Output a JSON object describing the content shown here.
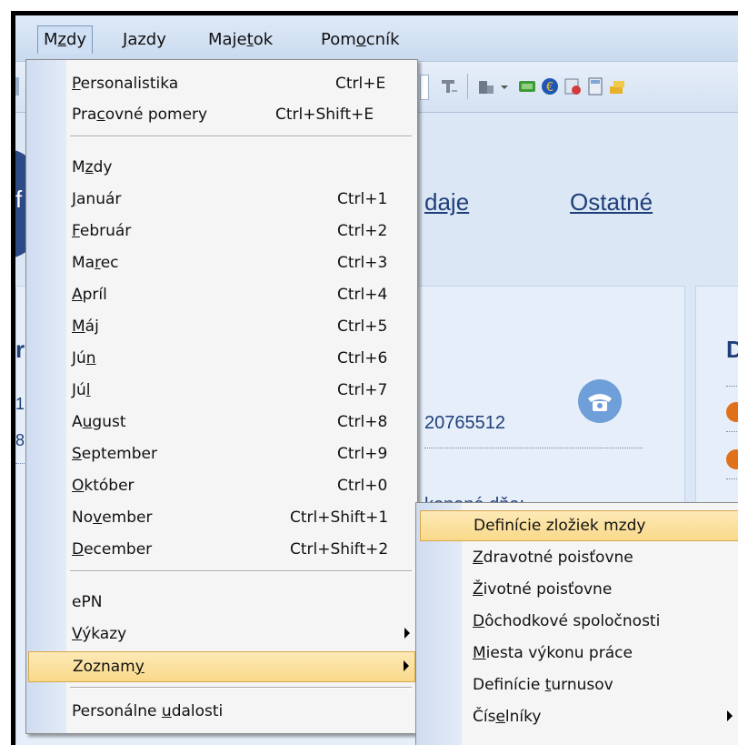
{
  "menubar": {
    "items": [
      {
        "pre": "M",
        "acc": "z",
        "post": "dy"
      },
      {
        "pre": "",
        "acc": "J",
        "post": "azdy"
      },
      {
        "pre": "Maje",
        "acc": "t",
        "post": "ok"
      },
      {
        "pre": "Pom",
        "acc": "o",
        "post": "cník"
      }
    ]
  },
  "nav": {
    "udaje": "daje",
    "ostatne": "Ostatné"
  },
  "fragments": {
    "left_f": "f",
    "left_r": "r",
    "left_n1": "1",
    "left_n2": "8",
    "phone": "20765512",
    "label": "konaná dňa:",
    "right_d": "D"
  },
  "main_menu": {
    "group1": [
      {
        "pre": "",
        "acc": "P",
        "post": "ersonalistika",
        "shortcut": "Ctrl+E"
      },
      {
        "pre": "Pra",
        "acc": "c",
        "post": "ovné pomery",
        "shortcut": "Ctrl+Shift+E"
      }
    ],
    "group2": [
      {
        "pre": "M",
        "acc": "z",
        "post": "dy",
        "shortcut": ""
      },
      {
        "pre": "",
        "acc": "J",
        "post": "anuár",
        "shortcut": "Ctrl+1"
      },
      {
        "pre": "",
        "acc": "F",
        "post": "ebruár",
        "shortcut": "Ctrl+2"
      },
      {
        "pre": "Ma",
        "acc": "r",
        "post": "ec",
        "shortcut": "Ctrl+3"
      },
      {
        "pre": "",
        "acc": "A",
        "post": "príl",
        "shortcut": "Ctrl+4"
      },
      {
        "pre": "",
        "acc": "M",
        "post": "áj",
        "shortcut": "Ctrl+5"
      },
      {
        "pre": "Jú",
        "acc": "n",
        "post": "",
        "shortcut": "Ctrl+6"
      },
      {
        "pre": "Jú",
        "acc": "l",
        "post": "",
        "shortcut": "Ctrl+7"
      },
      {
        "pre": "A",
        "acc": "u",
        "post": "gust",
        "shortcut": "Ctrl+8"
      },
      {
        "pre": "",
        "acc": "S",
        "post": "eptember",
        "shortcut": "Ctrl+9"
      },
      {
        "pre": "",
        "acc": "O",
        "post": "któber",
        "shortcut": "Ctrl+0"
      },
      {
        "pre": "No",
        "acc": "v",
        "post": "ember",
        "shortcut": "Ctrl+Shift+1"
      },
      {
        "pre": "",
        "acc": "D",
        "post": "ecember",
        "shortcut": "Ctrl+Shift+2"
      }
    ],
    "group3": [
      {
        "pre": "ePN",
        "acc": "",
        "post": ""
      },
      {
        "pre": "",
        "acc": "V",
        "post": "ýkazy",
        "submenu": true
      },
      {
        "pre": "Zoznam",
        "acc": "y",
        "post": "",
        "submenu": true,
        "highlighted": true
      }
    ],
    "group4": [
      {
        "pre": "Personálne ",
        "acc": "u",
        "post": "dalosti"
      }
    ]
  },
  "submenu": {
    "items": [
      {
        "pre": "Definície zložiek mzdy",
        "acc": "",
        "post": "",
        "highlighted": true
      },
      {
        "pre": "",
        "acc": "Z",
        "post": "dravotné poisťovne"
      },
      {
        "pre": "",
        "acc": "Ž",
        "post": "ivotné poisťovne"
      },
      {
        "pre": "",
        "acc": "D",
        "post": "ôchodkové spoločnosti"
      },
      {
        "pre": "",
        "acc": "M",
        "post": "iesta výkonu práce"
      },
      {
        "pre": "Definície ",
        "acc": "t",
        "post": "urnusov"
      },
      {
        "pre": "Čís",
        "acc": "e",
        "post": "lníky",
        "submenu": true
      }
    ]
  },
  "colors": {
    "highlight": "#f9d98a",
    "gutter": "#cfdcf0",
    "link": "#1f3f7a",
    "phone_icon": "#6f9fd8",
    "orange": "#e0701a"
  }
}
